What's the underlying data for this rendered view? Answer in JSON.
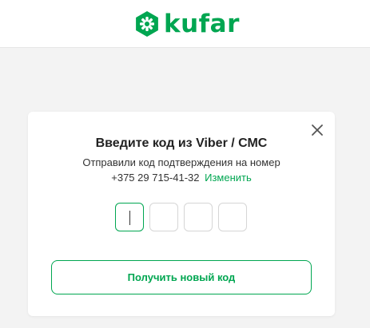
{
  "brand": {
    "name": "kufar",
    "color": "#00a651",
    "logo_icon": "kufar-logo-icon"
  },
  "modal": {
    "title": "Введите код из Viber / СМС",
    "subtitle_line1": "Отправили код подтверждения на номер",
    "phone": "+375 29 715-41-32",
    "change_link": "Изменить",
    "close_icon": "close-icon",
    "code_boxes_count": 4,
    "active_code_box": 1,
    "resend_button": "Получить новый код"
  }
}
